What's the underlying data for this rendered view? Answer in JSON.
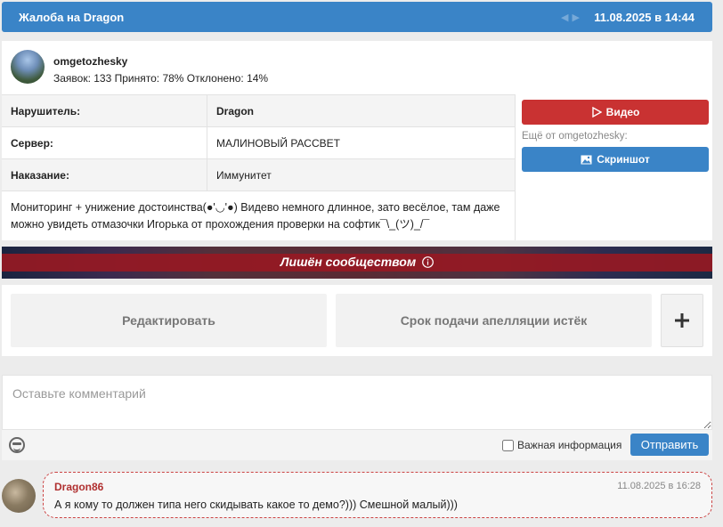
{
  "header": {
    "title": "Жалоба на Dragon",
    "date": "11.08.2025 в 14:44",
    "nav_arrows": "◀▶"
  },
  "author": {
    "name": "omgetozhesky",
    "stats": "Заявок: 133 Принято: 78% Отклонено: 14%",
    "avatar_icon": "user-avatar"
  },
  "details": {
    "rows": [
      {
        "label": "Нарушитель:",
        "value": "Dragon"
      },
      {
        "label": "Сервер:",
        "value": "МАЛИНОВЫЙ РАССВЕТ"
      },
      {
        "label": "Наказание:",
        "value": "Иммунитет"
      }
    ],
    "description": "Мониторинг + унижение достоинства(●'◡'●) Видево немного длинное, зато весёлое, там даже можно увидеть отмазочки Игорька от прохождения проверки на софтик¯\\_(ツ)_/¯"
  },
  "side": {
    "video_label": "Видео",
    "video_icon": "play-icon",
    "more_from": "Ещё от omgetozhesky:",
    "screenshot_label": "Скриншот",
    "screenshot_icon": "image-icon"
  },
  "banner": {
    "text": "Лишён сообществом",
    "icon": "info-icon"
  },
  "actions": {
    "edit": "Редактировать",
    "appeal": "Срок подачи апелляции истёк",
    "plus": "+"
  },
  "comment_form": {
    "placeholder": "Оставьте комментарий",
    "important_label": "Важная информация",
    "send_label": "Отправить",
    "emoji_icon": "emoji-icon"
  },
  "reply": {
    "author": "Dragon86",
    "date": "11.08.2025 в 16:28",
    "text": "А я кому то должен типа него скидывать какое то демо?))) Смешной малый)))"
  },
  "colors": {
    "primary": "#3a84c7",
    "danger": "#c93232",
    "reply_name": "#b03030"
  }
}
